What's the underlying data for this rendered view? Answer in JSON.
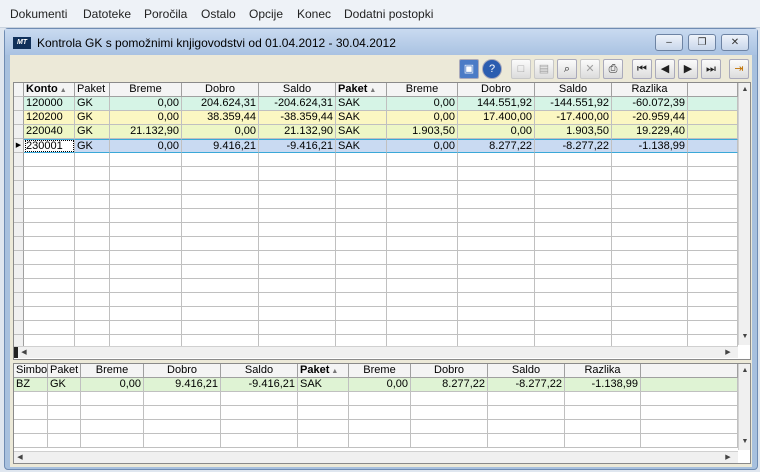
{
  "menu": [
    "Dokumenti",
    "Datoteke",
    "Poročila",
    "Ostalo",
    "Opcije",
    "Konec",
    "Dodatni postopki"
  ],
  "window": {
    "title": "Kontrola GK s pomožnimi knjigovodstvi od 01.04.2012 - 30.04.2012",
    "icon_text": "MT",
    "minimize_icon": "minimize-icon",
    "restore_icon": "restore-icon",
    "close_icon": "close-icon"
  },
  "toolbar_icons": [
    "monitor-icon",
    "help-icon",
    "new-document-icon",
    "open-folder-icon",
    "search-icon",
    "delete-icon",
    "print-icon",
    "first-record-icon",
    "previous-record-icon",
    "next-record-icon",
    "last-record-icon",
    "exit-icon"
  ],
  "top_table": {
    "headers": [
      "Konto",
      "Paket",
      "Breme",
      "Dobro",
      "Saldo",
      "Paket",
      "Breme",
      "Dobro",
      "Saldo",
      "Razlika"
    ],
    "rows": [
      [
        "120000",
        "GK",
        "0,00",
        "204.624,31",
        "-204.624,31",
        "SAK",
        "0,00",
        "144.551,92",
        "-144.551,92",
        "-60.072,39"
      ],
      [
        "120200",
        "GK",
        "0,00",
        "38.359,44",
        "-38.359,44",
        "SAK",
        "0,00",
        "17.400,00",
        "-17.400,00",
        "-20.959,44"
      ],
      [
        "220040",
        "GK",
        "21.132,90",
        "0,00",
        "21.132,90",
        "SAK",
        "1.903,50",
        "0,00",
        "1.903,50",
        "19.229,40"
      ],
      [
        "230001",
        "GK",
        "0,00",
        "9.416,21",
        "-9.416,21",
        "SAK",
        "0,00",
        "8.277,22",
        "-8.277,22",
        "-1.138,99"
      ]
    ],
    "row_colors": [
      "#d6f4e6",
      "#fbf7c2",
      "#edf7c6",
      "#c9daf2"
    ],
    "selected_row": 3
  },
  "bottom_table": {
    "headers": [
      "Simbol",
      "Paket",
      "Breme",
      "Dobro",
      "Saldo",
      "Paket",
      "Breme",
      "Dobro",
      "Saldo",
      "Razlika"
    ],
    "rows": [
      [
        "BZ",
        "GK",
        "0,00",
        "9.416,21",
        "-9.416,21",
        "SAK",
        "0,00",
        "8.277,22",
        "-8.277,22",
        "-1.138,99"
      ]
    ],
    "row_color": "#dff3d4"
  }
}
